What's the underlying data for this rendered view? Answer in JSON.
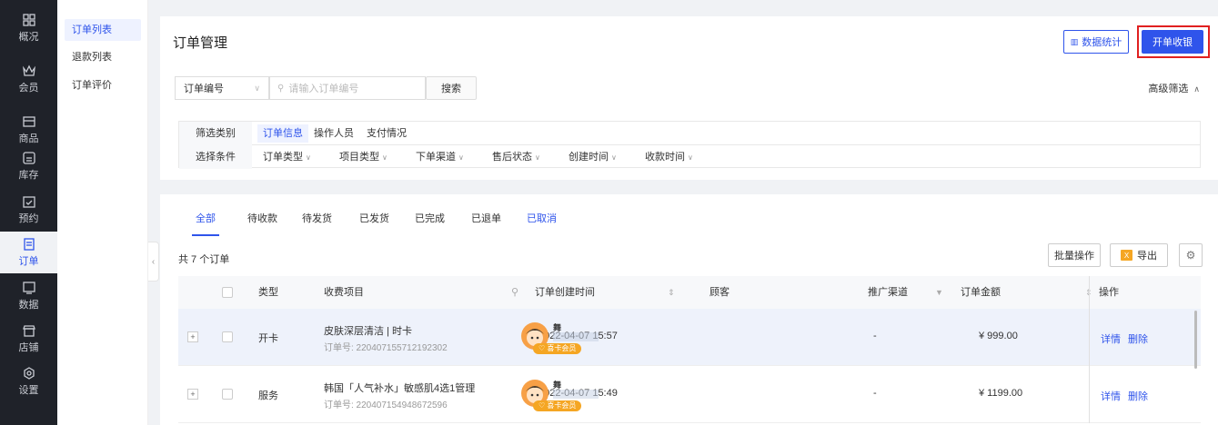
{
  "nav": {
    "items": [
      {
        "label": "概况",
        "icon": "dashboard-icon"
      },
      {
        "label": "会员",
        "icon": "crown-icon"
      },
      {
        "label": "商品",
        "icon": "product-icon"
      },
      {
        "label": "库存",
        "icon": "inventory-icon"
      },
      {
        "label": "预约",
        "icon": "calendar-icon"
      },
      {
        "label": "订单",
        "icon": "order-icon"
      },
      {
        "label": "数据",
        "icon": "data-icon"
      },
      {
        "label": "店铺",
        "icon": "shop-icon"
      },
      {
        "label": "设置",
        "icon": "settings-icon"
      }
    ],
    "active": "订单"
  },
  "subnav": {
    "items": [
      "订单列表",
      "退款列表",
      "订单评价"
    ],
    "active": "订单列表"
  },
  "header": {
    "title": "订单管理",
    "stats_label": "数据统计",
    "open_label": "开单收银"
  },
  "search": {
    "type_value": "订单编号",
    "placeholder": "请输入订单编号",
    "button_label": "搜索",
    "advanced_label": "高级筛选"
  },
  "filters": {
    "row1_label": "筛选类别",
    "categories": [
      "订单信息",
      "操作人员",
      "支付情况"
    ],
    "row2_label": "选择条件",
    "conditions": [
      "订单类型",
      "项目类型",
      "下单渠道",
      "售后状态",
      "创建时间",
      "收款时间"
    ]
  },
  "tabs": [
    "全部",
    "待收款",
    "待发货",
    "已发货",
    "已完成",
    "已退单",
    "已取消"
  ],
  "list": {
    "count_text": "共 7 个订单",
    "batch_label": "批量操作",
    "export_label": "导出",
    "export_badge": "excel-icon"
  },
  "table": {
    "headers": {
      "type": "类型",
      "project": "收费项目",
      "created": "订单创建时间",
      "customer": "顾客",
      "channel": "推广渠道",
      "amount": "订单金额",
      "actions": "操作"
    },
    "rows": [
      {
        "type": "开卡",
        "project": "皮肤深层清洁 | 时卡",
        "order_no": "订单号: 220407155712192302",
        "created": "2022-04-07 15:57",
        "customer_name": "舞",
        "customer_badge": "♡ 喜卡会员",
        "channel": "-",
        "amount": "¥ 999.00",
        "detail": "详情",
        "delete": "删除"
      },
      {
        "type": "服务",
        "project": "韩国「人气补水」敏感肌4选1管理",
        "order_no": "订单号: 220407154948672596",
        "created": "2022-04-07 15:49",
        "customer_name": "舞",
        "customer_badge": "♡ 喜卡会员",
        "channel": "-",
        "amount": "¥ 1199.00",
        "detail": "详情",
        "delete": "删除"
      }
    ]
  },
  "colors": {
    "primary": "#2f54eb",
    "nav_bg": "#1f2229",
    "highlight_border": "#e02020",
    "badge": "#f5a623"
  }
}
